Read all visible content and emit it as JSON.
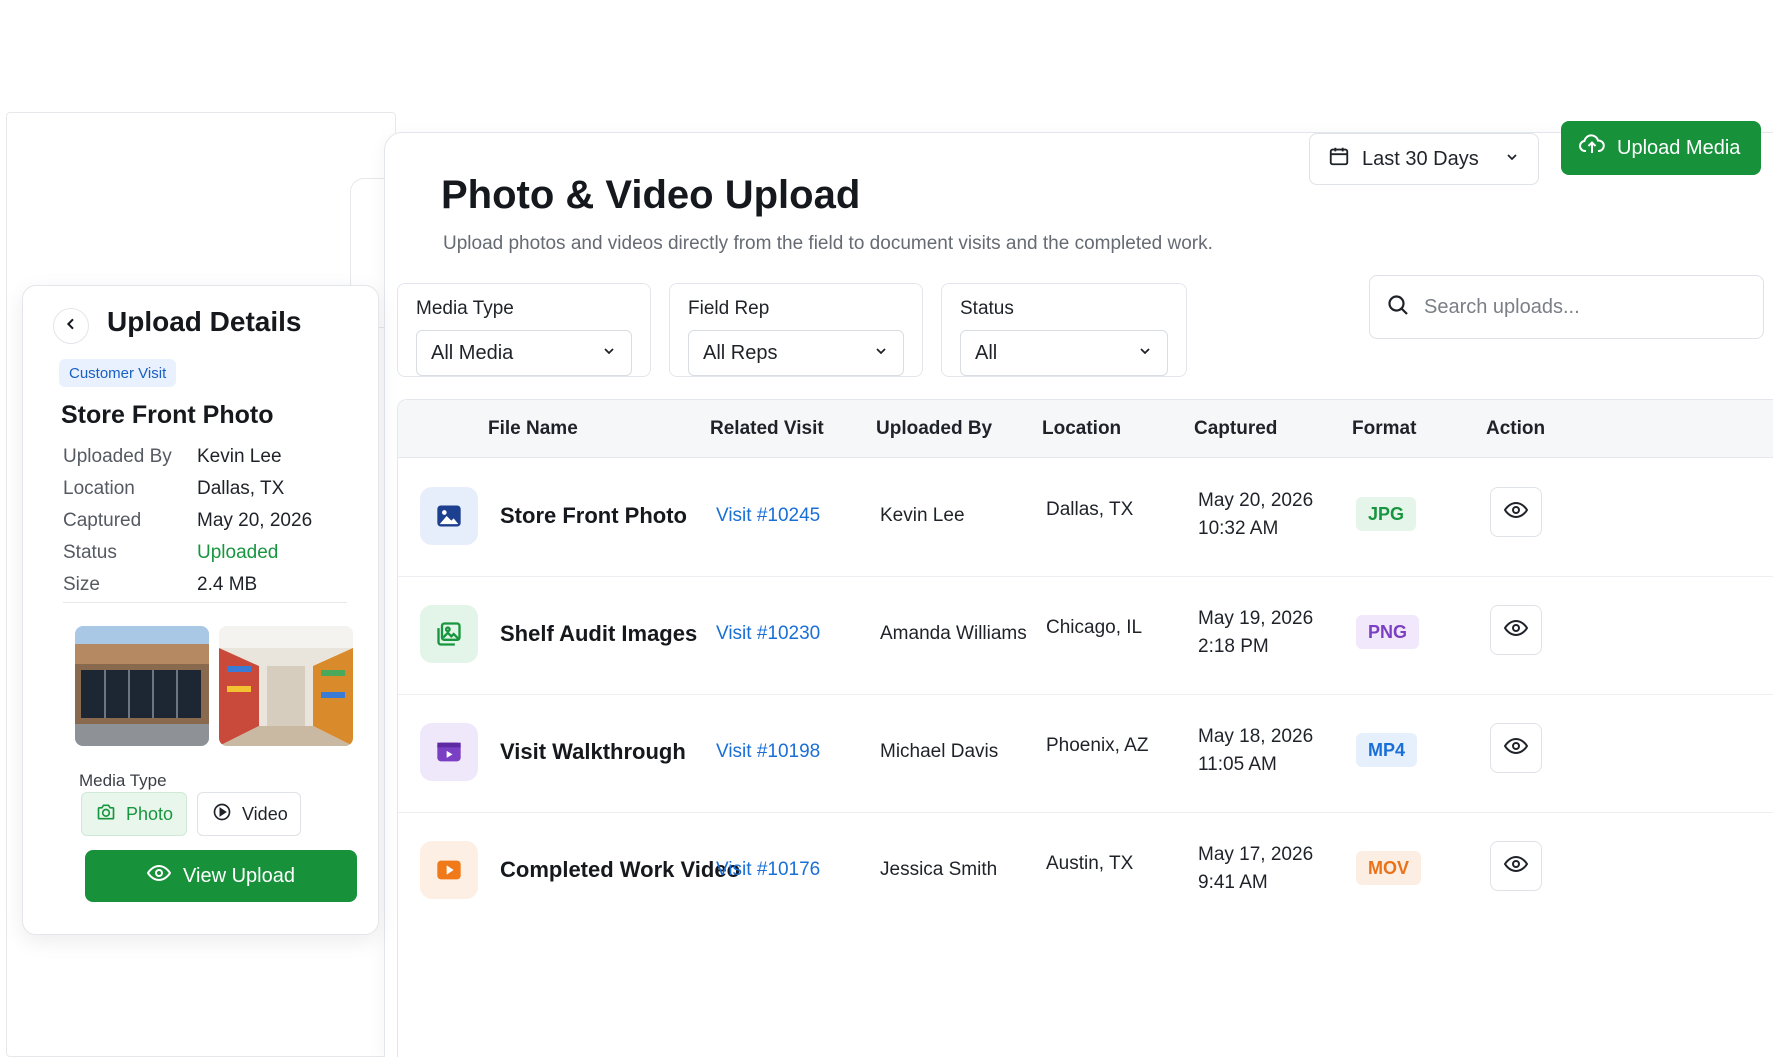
{
  "header": {
    "title": "Photo & Video Upload",
    "subtitle": "Upload photos and videos directly from the field to document visits and the completed work.",
    "date_range": "Last 30 Days",
    "upload_button": "Upload Media"
  },
  "filters": {
    "media_type": {
      "label": "Media Type",
      "value": "All Media"
    },
    "field_rep": {
      "label": "Field Rep",
      "value": "All Reps"
    },
    "status": {
      "label": "Status",
      "value": "All"
    },
    "search_placeholder": "Search uploads..."
  },
  "table": {
    "columns": [
      "File Name",
      "Related Visit",
      "Uploaded By",
      "Location",
      "Captured",
      "Format",
      "Action"
    ],
    "rows": [
      {
        "file": "Store Front Photo",
        "visit": "Visit #10245",
        "uploader": "Kevin Lee",
        "location": "Dallas, TX",
        "date": "May 20, 2026",
        "time": "10:32 AM",
        "format": "JPG",
        "icon": "image-icon"
      },
      {
        "file": "Shelf Audit Images",
        "visit": "Visit #10230",
        "uploader": "Amanda Williams",
        "location": "Chicago, IL",
        "date": "May 19, 2026",
        "time": "2:18 PM",
        "format": "PNG",
        "icon": "gallery-icon"
      },
      {
        "file": "Visit Walkthrough",
        "visit": "Visit #10198",
        "uploader": "Michael Davis",
        "location": "Phoenix, AZ",
        "date": "May 18, 2026",
        "time": "11:05 AM",
        "format": "MP4",
        "icon": "video-clip-icon"
      },
      {
        "file": "Completed Work Video",
        "visit": "Visit #10176",
        "uploader": "Jessica Smith",
        "location": "Austin, TX",
        "date": "May 17, 2026",
        "time": "9:41 AM",
        "format": "MOV",
        "icon": "play-icon"
      }
    ]
  },
  "details": {
    "title": "Upload Details",
    "tag": "Customer Visit",
    "record_title": "Store Front Photo",
    "fields": [
      {
        "key": "Uploaded By",
        "value": "Kevin Lee"
      },
      {
        "key": "Location",
        "value": "Dallas, TX"
      },
      {
        "key": "Captured",
        "value": "May 20, 2026"
      },
      {
        "key": "Status",
        "value": "Uploaded"
      },
      {
        "key": "Size",
        "value": "2.4 MB"
      }
    ],
    "media_type_label": "Media Type",
    "photo_option": "Photo",
    "video_option": "Video",
    "view_button": "View Upload"
  },
  "colors": {
    "primary_green": "#17923a",
    "link_blue": "#1a6fd6",
    "jpg": "#18963f",
    "png": "#7b3fc4",
    "mp4": "#1a6fd6",
    "mov": "#e8731a"
  }
}
